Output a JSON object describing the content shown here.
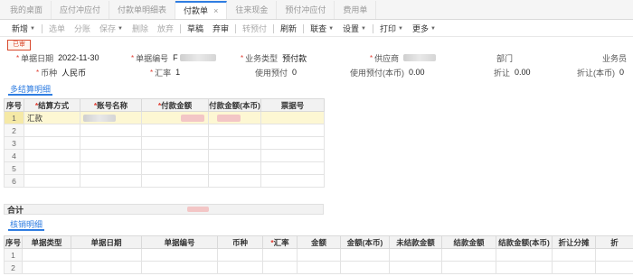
{
  "tabs": [
    {
      "label": "我的桌面",
      "active": false
    },
    {
      "label": "应付冲应付",
      "active": false
    },
    {
      "label": "付款单明细表",
      "active": false
    },
    {
      "label": "付款单",
      "active": true,
      "close": "×"
    },
    {
      "label": "往来现金",
      "active": false
    },
    {
      "label": "预付冲应付",
      "active": false
    },
    {
      "label": "费用单",
      "active": false
    }
  ],
  "toolbar": [
    {
      "label": "新增",
      "dropdown": true,
      "disabled": false
    },
    {
      "label": "选单",
      "dropdown": false,
      "disabled": true
    },
    {
      "label": "分账",
      "dropdown": false,
      "disabled": true
    },
    {
      "label": "保存",
      "dropdown": true,
      "disabled": true
    },
    {
      "label": "删除",
      "dropdown": false,
      "disabled": true
    },
    {
      "label": "放弃",
      "dropdown": false,
      "disabled": true
    },
    {
      "label": "草稿",
      "dropdown": false,
      "disabled": false
    },
    {
      "label": "弃审",
      "dropdown": false,
      "disabled": false
    },
    {
      "label": "转预付",
      "dropdown": false,
      "disabled": true
    },
    {
      "label": "刷新",
      "dropdown": false,
      "disabled": false
    },
    {
      "label": "联查",
      "dropdown": true,
      "disabled": false
    },
    {
      "label": "设置",
      "dropdown": true,
      "disabled": false
    },
    {
      "label": "打印",
      "dropdown": true,
      "disabled": false
    },
    {
      "label": "更多",
      "dropdown": true,
      "disabled": false
    }
  ],
  "caret": "▼",
  "status_stamp": "已审",
  "header": {
    "doc_date_label": "单据日期",
    "doc_date": "2022-11-30",
    "doc_no_label": "单据编号",
    "doc_no_prefix": "F",
    "biz_type_label": "业务类型",
    "biz_type": "预付款",
    "supplier_label": "供应商",
    "dept_label": "部门",
    "salesman_label": "业务员",
    "currency_label": "币种",
    "currency": "人民币",
    "rate_label": "汇率",
    "rate": "1",
    "use_prepay_label": "使用预付",
    "use_prepay": "0",
    "use_prepay_base_label": "使用预付(本币)",
    "use_prepay_base": "0.00",
    "discount_label": "折让",
    "discount": "0.00",
    "discount_base_label": "折让(本币)",
    "discount_base": "0"
  },
  "settlement": {
    "section_title": "多结算明细",
    "columns": [
      "序号",
      "结算方式",
      "账号名称",
      "付款金额",
      "付款金额(本币)",
      "票据号"
    ],
    "required": [
      false,
      true,
      true,
      true,
      false,
      false
    ],
    "rows": [
      {
        "no": "1",
        "method": "汇款"
      },
      {
        "no": "2"
      },
      {
        "no": "3"
      },
      {
        "no": "4"
      },
      {
        "no": "5"
      },
      {
        "no": "6"
      }
    ],
    "total_label": "合计"
  },
  "writeoff": {
    "section_title": "核销明细",
    "columns": [
      "序号",
      "单据类型",
      "单据日期",
      "单据编号",
      "币种",
      "汇率",
      "金额",
      "金额(本币)",
      "未结款金额",
      "结款金额",
      "结款金额(本币)",
      "折让分摊",
      "折"
    ],
    "required": [
      false,
      false,
      false,
      false,
      false,
      true,
      false,
      false,
      false,
      false,
      false,
      false,
      false
    ],
    "rows": [
      {
        "no": "1"
      },
      {
        "no": "2"
      }
    ]
  },
  "colors": {
    "accent": "#2f7de1",
    "required": "#e03c31",
    "stamp": "#d84a2e",
    "selected_row": "#fdf7d3"
  }
}
